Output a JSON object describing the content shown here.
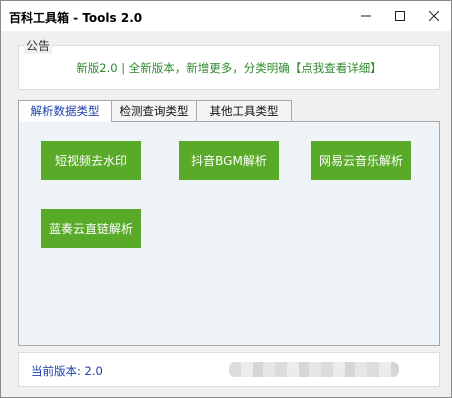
{
  "window": {
    "title": "百科工具箱 - Tools 2.0"
  },
  "notice": {
    "legend": "公告",
    "text": "新版2.0 | 全新版本，新增更多，分类明确【点我查看详细】"
  },
  "tabs": [
    {
      "label": "解析数据类型",
      "active": true
    },
    {
      "label": "检测查询类型",
      "active": false
    },
    {
      "label": "其他工具类型",
      "active": false
    }
  ],
  "buttons": [
    {
      "label": "短视频去水印"
    },
    {
      "label": "抖音BGM解析"
    },
    {
      "label": "网易云音乐解析"
    },
    {
      "label": "蓝奏云直链解析"
    }
  ],
  "status": {
    "version_label": "当前版本: 2.0"
  },
  "colors": {
    "accent_green": "#5aaa2a",
    "notice_text": "#2f8a2f",
    "link_blue": "#1c3fa8"
  }
}
